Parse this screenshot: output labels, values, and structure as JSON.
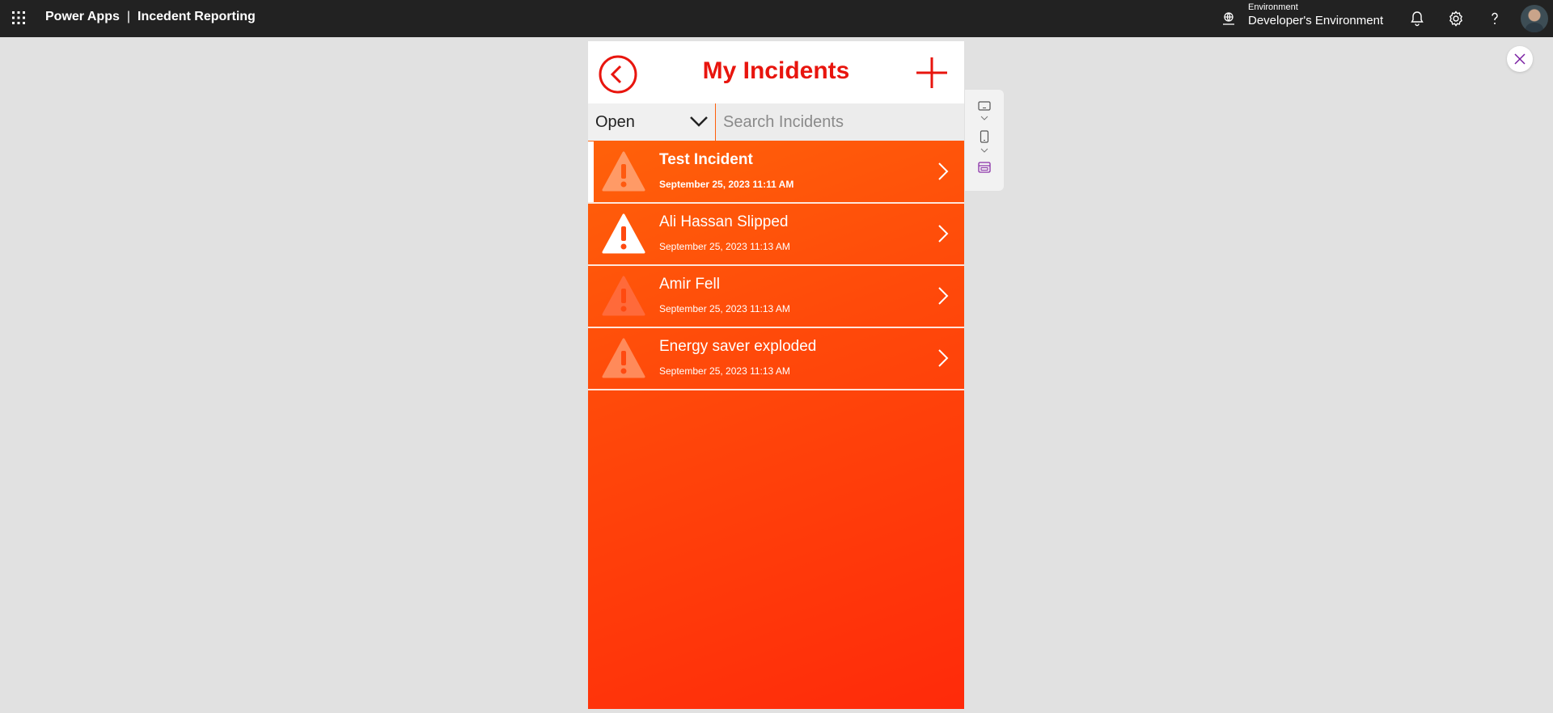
{
  "topbar": {
    "app_name": "Power Apps",
    "separator": "|",
    "app_title": "Incedent Reporting",
    "environment_label": "Environment",
    "environment_value": "Developer's Environment",
    "icons": [
      "waffle-icon",
      "environment-icon",
      "bell-icon",
      "gear-icon",
      "help-icon",
      "avatar"
    ]
  },
  "app": {
    "title": "My Incidents",
    "status_value": "Open",
    "search_placeholder": "Search Incidents",
    "accent_color": "#e8150e",
    "gradient_colors": [
      "#ff6a0a",
      "#ff2a0a"
    ]
  },
  "incidents": [
    {
      "title": "Test Incident",
      "date": "September 25, 2023 11:11 AM",
      "selected": true
    },
    {
      "title": "Ali Hassan Slipped",
      "date": "September 25, 2023 11:13 AM",
      "selected": false
    },
    {
      "title": "Amir Fell",
      "date": "September 25, 2023 11:13 AM",
      "selected": false
    },
    {
      "title": "Energy saver exploded",
      "date": "September 25, 2023 11:13 AM",
      "selected": false
    }
  ]
}
